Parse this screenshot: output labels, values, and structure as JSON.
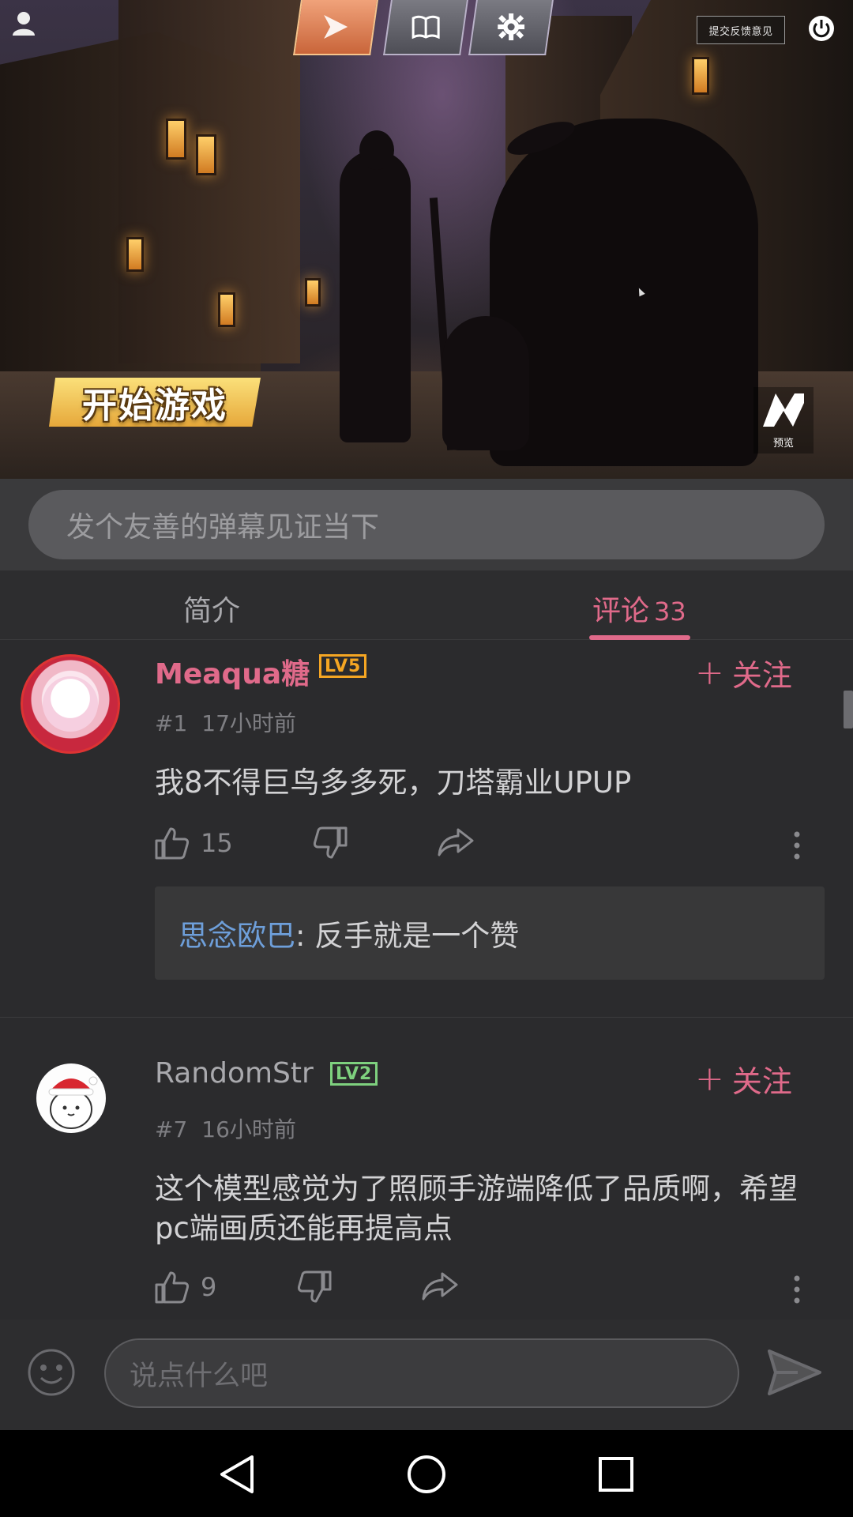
{
  "hero": {
    "feedback_label": "提交反馈意见",
    "start_label": "开始游戏",
    "preview_label": "预览"
  },
  "danmaku": {
    "placeholder": "发个友善的弹幕见证当下"
  },
  "tabs": {
    "intro": "简介",
    "comments": "评论",
    "comments_count": "33"
  },
  "comments": [
    {
      "username": "Meaqua糖",
      "level": "LV5",
      "follow": "关注",
      "floor": "#1",
      "time": "17小时前",
      "text": "我8不得巨鸟多多死，刀塔霸业UPUP",
      "likes": "15",
      "reply": {
        "user": "思念欧巴",
        "text": ": 反手就是一个赞"
      }
    },
    {
      "username": "RandomStr",
      "level": "LV2",
      "follow": "关注",
      "floor": "#7",
      "time": "16小时前",
      "text": "这个模型感觉为了照顾手游端降低了品质啊，希望pc端画质还能再提高点",
      "likes": "9"
    }
  ],
  "composer": {
    "placeholder": "说点什么吧"
  },
  "colors": {
    "accent": "#e06a8a",
    "reply_user": "#6e9fda",
    "lv5": "#f5a623",
    "lv2": "#7ed07e"
  }
}
